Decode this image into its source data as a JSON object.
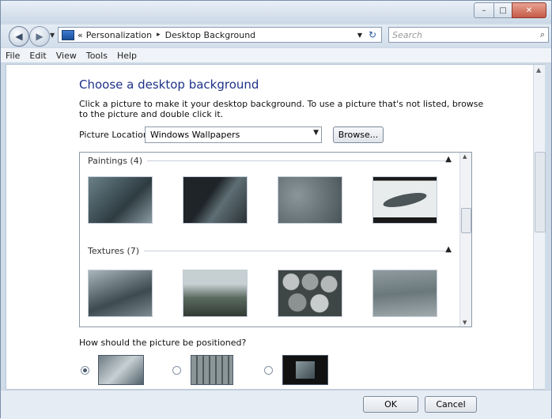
{
  "window": {
    "caption_buttons": [
      "–",
      "□",
      "✕"
    ]
  },
  "address": {
    "back_icon": "back-arrow",
    "forward_icon": "forward-arrow",
    "chevrons": "«",
    "crumb1": "Personalization",
    "separator": "▸",
    "crumb2": "Desktop Background",
    "refresh": "↻",
    "search_placeholder": "Search"
  },
  "menu": {
    "file": "File",
    "edit": "Edit",
    "view": "View",
    "tools": "Tools",
    "help": "Help"
  },
  "main": {
    "title": "Choose a desktop background",
    "description": "Click a picture to make it your desktop background. To use a picture that's not listed, browse to the picture and double click it.",
    "location_label": "Picture Location",
    "location_value": "Windows Wallpapers",
    "browse_label": "Browse...",
    "groups": [
      {
        "label": "Paintings (4)"
      },
      {
        "label": "Textures (7)"
      }
    ],
    "position_label": "How should the picture be positioned?"
  },
  "footer": {
    "ok_label": "OK",
    "cancel_label": "Cancel"
  }
}
